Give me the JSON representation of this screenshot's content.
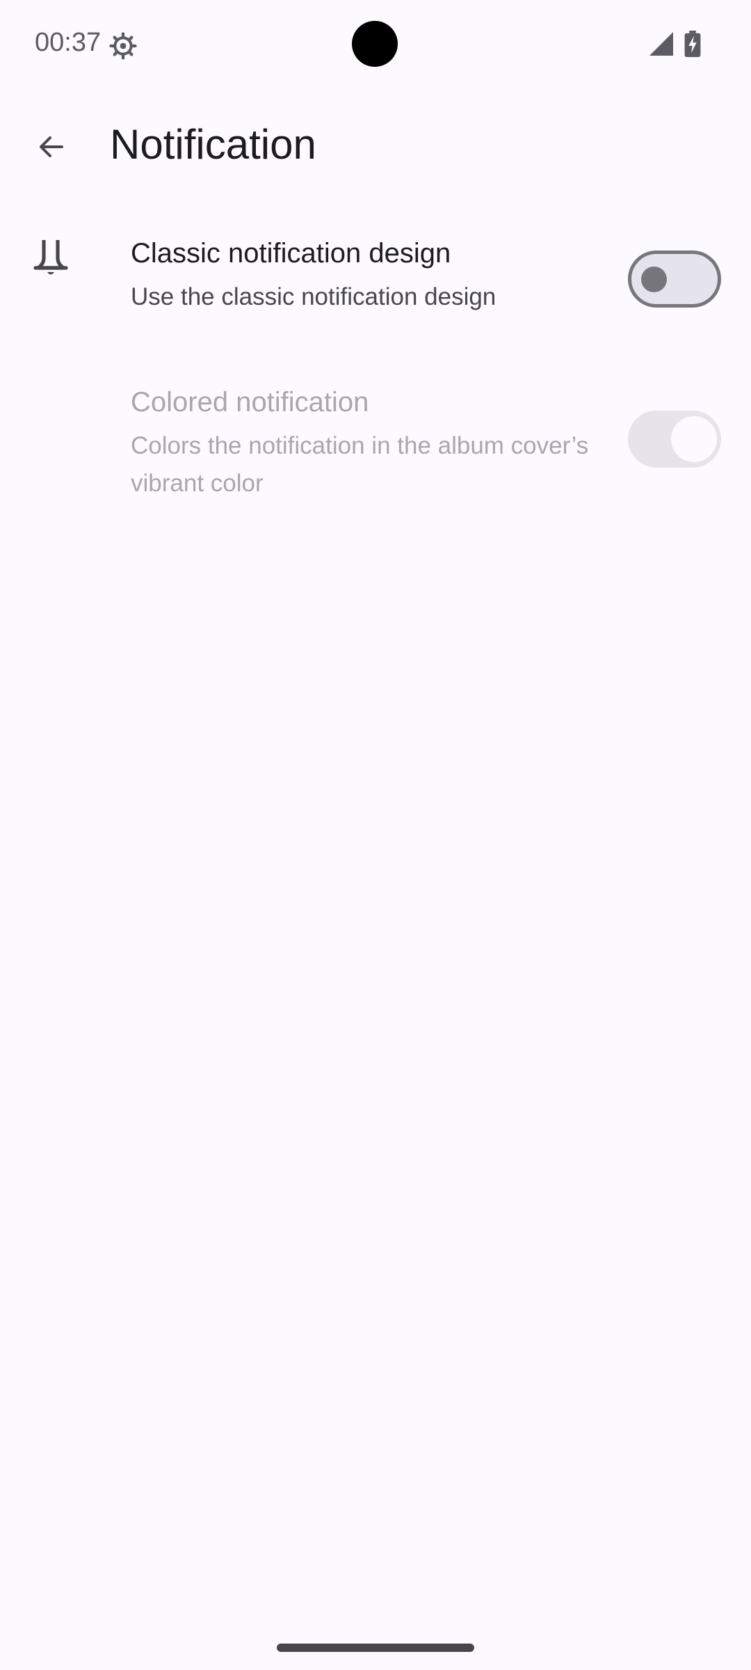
{
  "status_bar": {
    "time": "00:37",
    "icons": [
      "settings-gear-icon",
      "signal-icon",
      "battery-charging-icon"
    ]
  },
  "toolbar": {
    "back_icon": "arrow-back-icon",
    "title": "Notification"
  },
  "settings": {
    "classic": {
      "icon": "bell-icon",
      "title": "Classic notification design",
      "summary": "Use the classic notification design",
      "enabled": true,
      "checked": false
    },
    "colored": {
      "title": "Colored notification",
      "summary": "Colors the notification in the album cover’s vibrant color",
      "enabled": false,
      "checked": false
    }
  },
  "colors": {
    "background": "#fcfaff",
    "primary_text": "#1c1b20",
    "secondary_text": "#48464e",
    "disabled_text": "#a9a7ae",
    "switch_outline": "#77767d"
  }
}
